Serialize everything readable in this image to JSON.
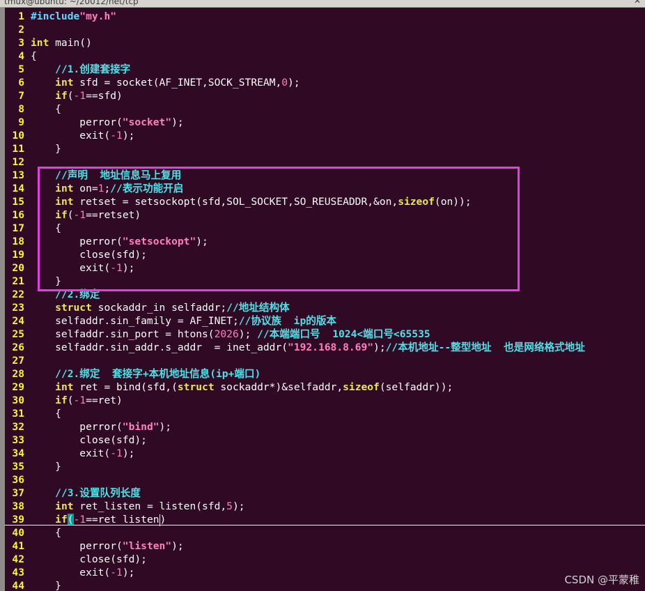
{
  "window": {
    "title": "tmux@ubuntu: ~/20012/net/tcp",
    "close_glyph": "✕"
  },
  "highlight": {
    "color": "#e33ee3",
    "first_line": 13,
    "last_line": 21
  },
  "cursor": {
    "line": 39
  },
  "watermark": "CSDN @平蒙稚",
  "code_lines": [
    {
      "n": 1,
      "segs": [
        [
          "#include",
          "p"
        ],
        [
          "\"my.h\"",
          "s"
        ]
      ]
    },
    {
      "n": 2,
      "segs": []
    },
    {
      "n": 3,
      "segs": [
        [
          "int",
          "k"
        ],
        [
          " main()",
          ""
        ]
      ]
    },
    {
      "n": 4,
      "segs": [
        [
          "{",
          ""
        ]
      ]
    },
    {
      "n": 5,
      "segs": [
        [
          "    ",
          ""
        ],
        [
          "//1.创建套接字",
          "c"
        ]
      ]
    },
    {
      "n": 6,
      "segs": [
        [
          "    ",
          ""
        ],
        [
          "int",
          "k"
        ],
        [
          " sfd = socket(AF_INET,SOCK_STREAM,",
          ""
        ],
        [
          "0",
          "n"
        ],
        [
          ");",
          ""
        ]
      ]
    },
    {
      "n": 7,
      "segs": [
        [
          "    ",
          ""
        ],
        [
          "if",
          "k"
        ],
        [
          "(",
          ""
        ],
        [
          "-1",
          "n"
        ],
        [
          "==sfd)",
          ""
        ]
      ]
    },
    {
      "n": 8,
      "segs": [
        [
          "    {",
          ""
        ]
      ]
    },
    {
      "n": 9,
      "segs": [
        [
          "        perror(",
          ""
        ],
        [
          "\"socket\"",
          "s"
        ],
        [
          ");",
          ""
        ]
      ]
    },
    {
      "n": 10,
      "segs": [
        [
          "        exit(",
          ""
        ],
        [
          "-1",
          "n"
        ],
        [
          ");",
          ""
        ]
      ]
    },
    {
      "n": 11,
      "segs": [
        [
          "    }",
          ""
        ]
      ]
    },
    {
      "n": 12,
      "segs": []
    },
    {
      "n": 13,
      "segs": [
        [
          "    ",
          ""
        ],
        [
          "//声明  地址信息马上复用",
          "c"
        ]
      ]
    },
    {
      "n": 14,
      "segs": [
        [
          "    ",
          ""
        ],
        [
          "int",
          "k"
        ],
        [
          " on=",
          ""
        ],
        [
          "1",
          "n"
        ],
        [
          ";",
          ""
        ],
        [
          "//表示功能开启",
          "c"
        ]
      ]
    },
    {
      "n": 15,
      "segs": [
        [
          "    ",
          ""
        ],
        [
          "int",
          "k"
        ],
        [
          " retset = setsockopt(sfd,SOL_SOCKET,SO_REUSEADDR,&on,",
          ""
        ],
        [
          "sizeof",
          "k"
        ],
        [
          "(on));",
          ""
        ]
      ]
    },
    {
      "n": 16,
      "segs": [
        [
          "    ",
          ""
        ],
        [
          "if",
          "k"
        ],
        [
          "(",
          ""
        ],
        [
          "-1",
          "n"
        ],
        [
          "==retset)",
          ""
        ]
      ]
    },
    {
      "n": 17,
      "segs": [
        [
          "    {",
          ""
        ]
      ]
    },
    {
      "n": 18,
      "segs": [
        [
          "        perror(",
          ""
        ],
        [
          "\"setsockopt\"",
          "s"
        ],
        [
          ");",
          ""
        ]
      ]
    },
    {
      "n": 19,
      "segs": [
        [
          "        close(sfd);",
          ""
        ]
      ]
    },
    {
      "n": 20,
      "segs": [
        [
          "        exit(",
          ""
        ],
        [
          "-1",
          "n"
        ],
        [
          ");",
          ""
        ]
      ]
    },
    {
      "n": 21,
      "segs": [
        [
          "    }",
          ""
        ]
      ]
    },
    {
      "n": 22,
      "segs": [
        [
          "    ",
          ""
        ],
        [
          "//2.绑定",
          "c"
        ]
      ]
    },
    {
      "n": 23,
      "segs": [
        [
          "    ",
          ""
        ],
        [
          "struct",
          "k"
        ],
        [
          " sockaddr_in selfaddr;",
          ""
        ],
        [
          "//地址结构体",
          "c"
        ]
      ]
    },
    {
      "n": 24,
      "segs": [
        [
          "    selfaddr.sin_family = AF_INET;",
          ""
        ],
        [
          "//协议族  ip的版本",
          "c"
        ]
      ]
    },
    {
      "n": 25,
      "segs": [
        [
          "    selfaddr.sin_port = htons(",
          ""
        ],
        [
          "2026",
          "n"
        ],
        [
          "); ",
          ""
        ],
        [
          "//本端端口号  1024<端口号<65535",
          "c"
        ]
      ]
    },
    {
      "n": 26,
      "segs": [
        [
          "    selfaddr.sin_addr.s_addr  = inet_addr(",
          ""
        ],
        [
          "\"192.168.8.69\"",
          "s"
        ],
        [
          ");",
          ""
        ],
        [
          "//本机地址--整型地址  也是网络格式地址",
          "c"
        ]
      ]
    },
    {
      "n": 27,
      "segs": []
    },
    {
      "n": 28,
      "segs": [
        [
          "    ",
          ""
        ],
        [
          "//2.绑定  套接字+本机地址信息(ip+端口)",
          "c"
        ]
      ]
    },
    {
      "n": 29,
      "segs": [
        [
          "    ",
          ""
        ],
        [
          "int",
          "k"
        ],
        [
          " ret = bind(sfd,(",
          ""
        ],
        [
          "struct",
          "k"
        ],
        [
          " sockaddr*)&selfaddr,",
          ""
        ],
        [
          "sizeof",
          "k"
        ],
        [
          "(selfaddr));",
          ""
        ]
      ]
    },
    {
      "n": 30,
      "segs": [
        [
          "    ",
          ""
        ],
        [
          "if",
          "k"
        ],
        [
          "(",
          ""
        ],
        [
          "-1",
          "n"
        ],
        [
          "==ret)",
          ""
        ]
      ]
    },
    {
      "n": 31,
      "segs": [
        [
          "    {",
          ""
        ]
      ]
    },
    {
      "n": 32,
      "segs": [
        [
          "        perror(",
          ""
        ],
        [
          "\"bind\"",
          "s"
        ],
        [
          ");",
          ""
        ]
      ]
    },
    {
      "n": 33,
      "segs": [
        [
          "        close(sfd);",
          ""
        ]
      ]
    },
    {
      "n": 34,
      "segs": [
        [
          "        exit(",
          ""
        ],
        [
          "-1",
          "n"
        ],
        [
          ");",
          ""
        ]
      ]
    },
    {
      "n": 35,
      "segs": [
        [
          "    }",
          ""
        ]
      ]
    },
    {
      "n": 36,
      "segs": []
    },
    {
      "n": 37,
      "segs": [
        [
          "    ",
          ""
        ],
        [
          "//3.设置队列长度",
          "c"
        ]
      ]
    },
    {
      "n": 38,
      "segs": [
        [
          "    ",
          ""
        ],
        [
          "int",
          "k"
        ],
        [
          " ret_listen = listen(sfd,",
          ""
        ],
        [
          "5",
          "n"
        ],
        [
          ");",
          ""
        ]
      ]
    },
    {
      "n": 39,
      "segs": [
        [
          "    ",
          ""
        ],
        [
          "if",
          "k"
        ],
        [
          "(",
          "hl"
        ],
        [
          "-1",
          "n"
        ],
        [
          "==ret_listen",
          ""
        ],
        [
          ")",
          "cur"
        ]
      ]
    },
    {
      "n": 40,
      "segs": [
        [
          "    {",
          ""
        ]
      ]
    },
    {
      "n": 41,
      "segs": [
        [
          "        perror(",
          ""
        ],
        [
          "\"listen\"",
          "s"
        ],
        [
          ");",
          ""
        ]
      ]
    },
    {
      "n": 42,
      "segs": [
        [
          "        close(sfd);",
          ""
        ]
      ]
    },
    {
      "n": 43,
      "segs": [
        [
          "        exit(",
          ""
        ],
        [
          "-1",
          "n"
        ],
        [
          ");",
          ""
        ]
      ]
    },
    {
      "n": 44,
      "segs": [
        [
          "    }",
          ""
        ]
      ]
    }
  ]
}
